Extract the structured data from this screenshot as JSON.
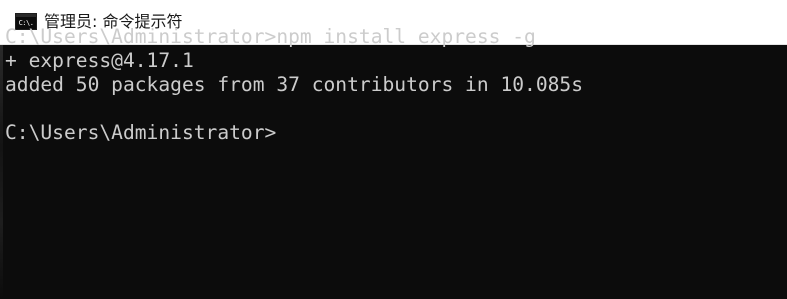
{
  "window": {
    "title": "管理员: 命令提示符",
    "icon": "cmd-icon",
    "icon_glyph": "C:\\."
  },
  "console": {
    "lines": [
      "C:\\Users\\Administrator>npm install express -g",
      "+ express@4.17.1",
      "added 50 packages from 37 contributors in 10.085s",
      "",
      "C:\\Users\\Administrator>"
    ]
  },
  "colors": {
    "titlebar_bg": "#ffffff",
    "console_bg": "#0c0c0c",
    "console_text": "#cccccc"
  }
}
